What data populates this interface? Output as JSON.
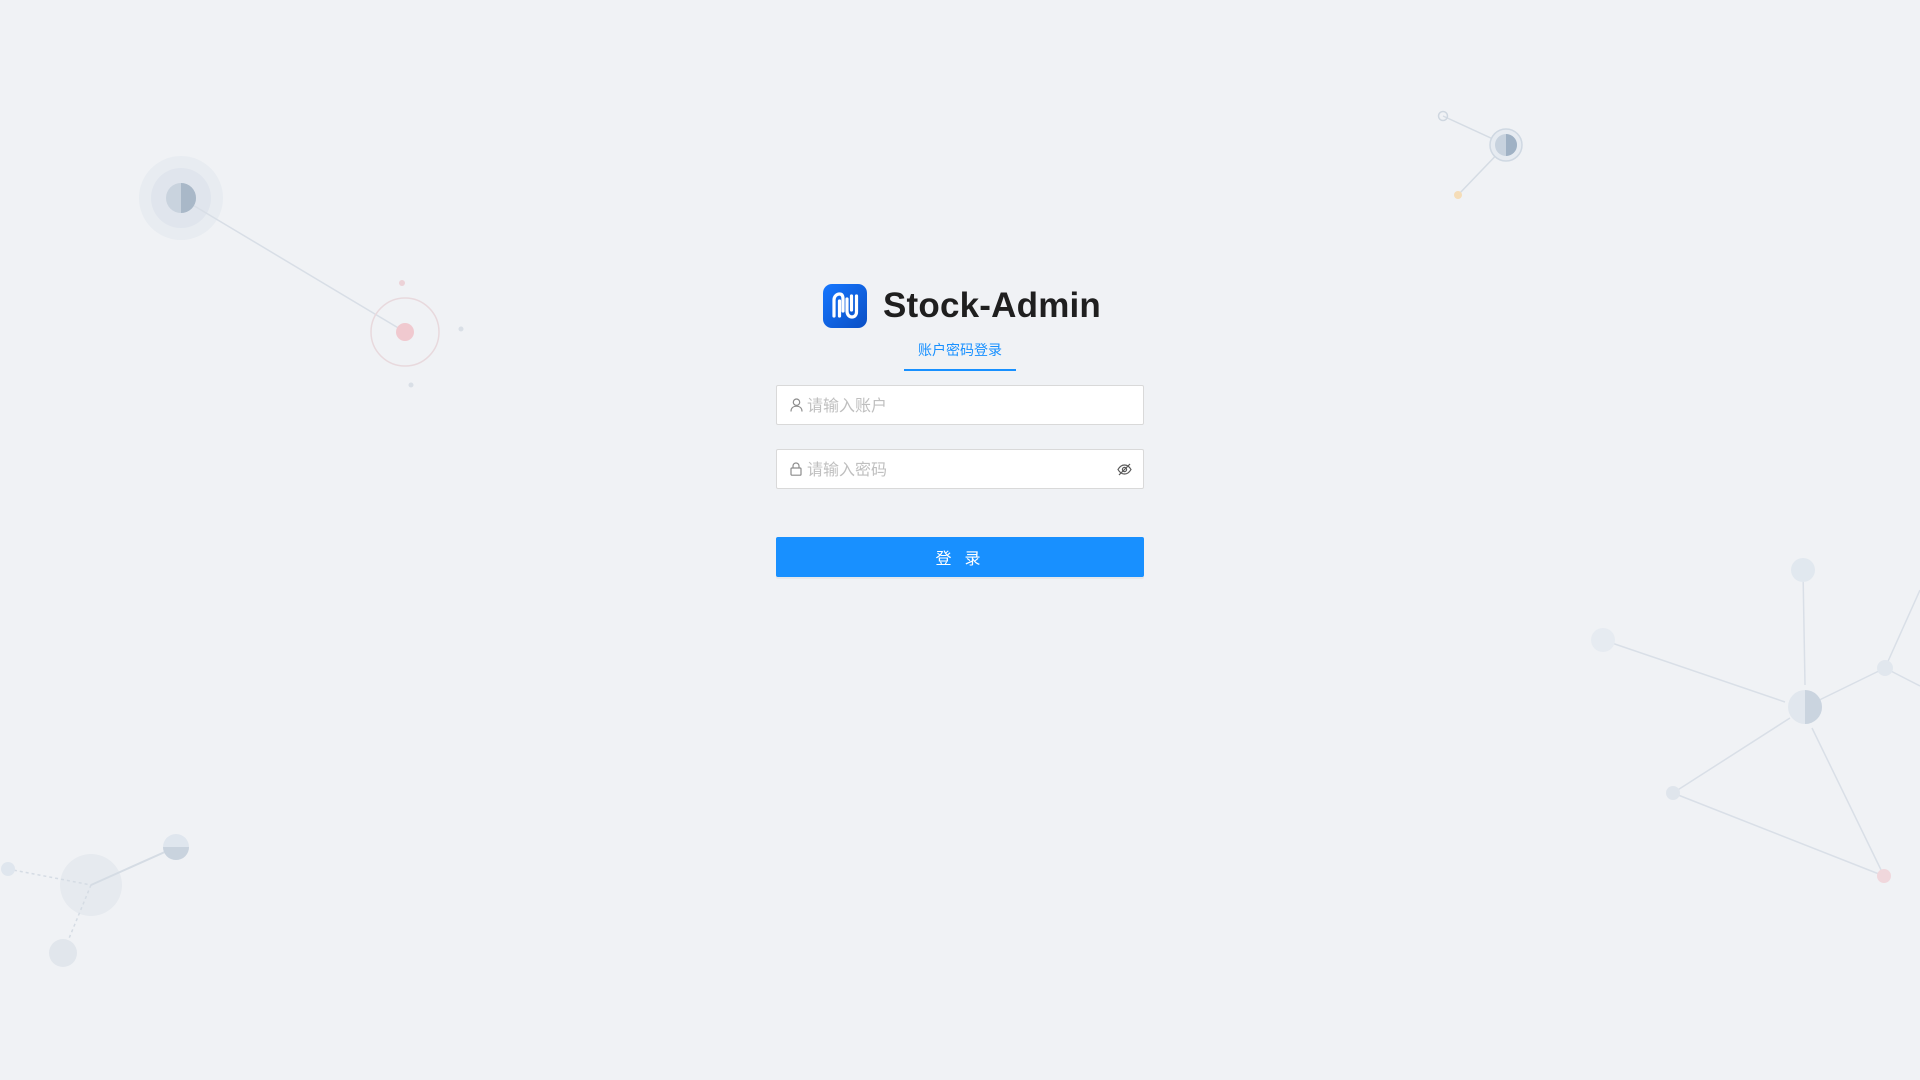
{
  "app": {
    "title": "Stock-Admin",
    "logo_icon": "stock-logo-icon",
    "accent_color": "#1890ff"
  },
  "login_tabs": [
    {
      "label": "账户密码登录",
      "active": true
    }
  ],
  "form": {
    "account": {
      "placeholder": "请输入账户",
      "value": "",
      "prefix_icon": "user-icon"
    },
    "password": {
      "placeholder": "请输入密码",
      "value": "",
      "prefix_icon": "lock-icon",
      "suffix_icon": "eye-invisible-icon"
    },
    "submit_label": "登 录"
  }
}
